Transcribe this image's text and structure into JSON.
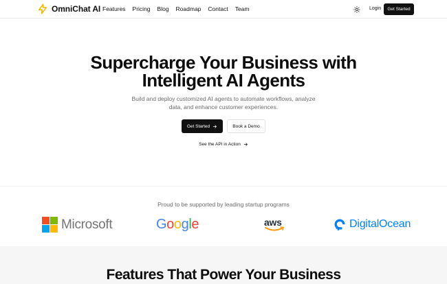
{
  "header": {
    "brand": "OmniChat AI",
    "nav": [
      "Features",
      "Pricing",
      "Blog",
      "Roadmap",
      "Contact",
      "Team"
    ],
    "theme_icon": "sun-icon",
    "login_label": "Login",
    "cta_label": "Get Started"
  },
  "hero": {
    "title_line1": "Supercharge Your Business with",
    "title_line2": "Intelligent AI Agents",
    "subtitle_line1": "Build and deploy customized AI agents to automate workflows, analyze",
    "subtitle_line2": "data, and enhance customer experiences.",
    "primary_label": "Get Started",
    "secondary_label": "Book a Demo",
    "api_link_label": "See the API in Action"
  },
  "partners": {
    "title": "Proud to be supported by leading startup programs",
    "logos": [
      "Microsoft",
      "Google",
      "aws",
      "DigitalOcean"
    ]
  },
  "features": {
    "title": "Features That Power Your Business"
  },
  "colors": {
    "primary": "#111111",
    "accent_logo": "#f5b800",
    "muted_text": "#6b6b6b",
    "digitalocean": "#0080ff",
    "aws_orange": "#ff9900"
  }
}
